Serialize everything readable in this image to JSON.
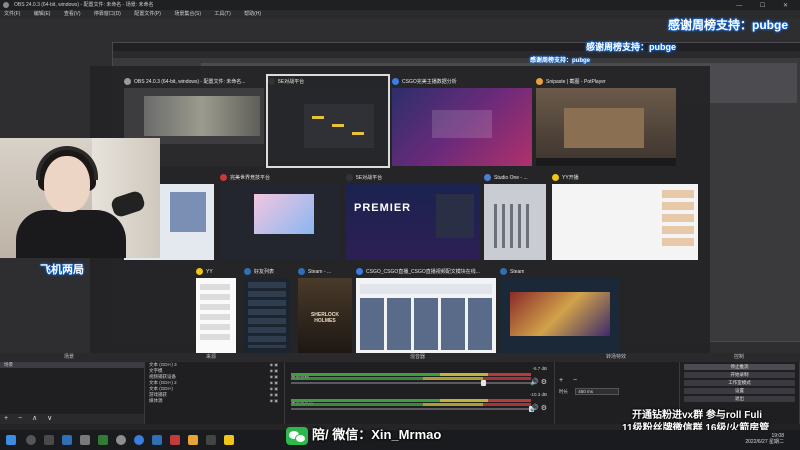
{
  "window": {
    "title": "OBS 24.0.3 (64-bit, windows) - 配置文件: 未命名 - 场景: 未命名",
    "controls": "— ☐ ✕"
  },
  "menu": [
    "文件(F)",
    "编辑(E)",
    "查看(V)",
    "停靠窗口(D)",
    "配置文件(P)",
    "场景集合(S)",
    "工具(T)",
    "帮助(H)"
  ],
  "sponsors": {
    "line1": "感谢周榜支持：pubge",
    "line2": "感谢周榜支持：pubge",
    "line3": "感谢周榜支持：pubge"
  },
  "webcam": {
    "caption": "飞机两局"
  },
  "switcher": {
    "windows": [
      {
        "label": "OBS 24.0.3 (64-bit, windows) - 配置文件: 未命名...",
        "icon_color": "#9a9a9a"
      },
      {
        "label": "5E对战平台",
        "icon_color": "#333333"
      },
      {
        "label": "CSGO完美主播数据分析",
        "icon_color": "#3b7de0"
      },
      {
        "label": "Snipaste | 截图 - PotPlayer",
        "icon_color": "#e8a23a"
      },
      {
        "label": "完美世界竞技平台",
        "icon_color": "#c33b3b"
      },
      {
        "label": "5E对战平台",
        "icon_color": "#333333"
      },
      {
        "label": "Studio One - ...",
        "icon_color": "#4a7fd1"
      },
      {
        "label": "YY开播",
        "icon_color": "#f0c419"
      },
      {
        "label": "YY",
        "icon_color": "#f0c419"
      },
      {
        "label": "好友列表",
        "icon_color": "#2f6fb5"
      },
      {
        "label": "Steam - ...",
        "icon_color": "#2f6fb5"
      },
      {
        "label": "CSGO_CSGO直播_CSGO直播视频配文模块在线...",
        "icon_color": "#3b7de0"
      },
      {
        "label": "Steam",
        "icon_color": "#2f6fb5"
      }
    ],
    "thumb_texts": {
      "premier": "PREMIER",
      "holmes": "SHERLOCK HOLMES"
    }
  },
  "docks": {
    "headers": [
      "场景",
      "来源",
      "混音器",
      "转场特效",
      "控制"
    ]
  },
  "scenes": {
    "items": [
      "场景"
    ]
  },
  "sources": {
    "items": [
      "文本 (GDI+) 3",
      "文字模",
      "视频捕获设备",
      "文本 (GDI+) 2",
      "文本 (GDI+)",
      "游戏捕获",
      "媒体源"
    ]
  },
  "mixer": {
    "tracks": [
      {
        "name": "桌面音频",
        "db": "-5.7 dB"
      },
      {
        "name": "麦克风/Aux",
        "db": "-10.3 dB"
      }
    ]
  },
  "transitions": {
    "duration_label": "时长",
    "duration_value": "450 ms"
  },
  "controls": {
    "buttons": [
      "停止推流",
      "开始录制",
      "工作室模式",
      "设置",
      "退出"
    ]
  },
  "promo": {
    "line1": "开通钻粉进vx群 参与roll Fuli",
    "line2": "11级粉丝牌微信群 16级/火箭房管",
    "wechat": "陪/ 微信：Xin_Mrmao"
  },
  "taskbar": {
    "time": "19:08",
    "date": "2022/6/27 星期二"
  },
  "toolbar_symbols": "+ − ∧ ∨"
}
